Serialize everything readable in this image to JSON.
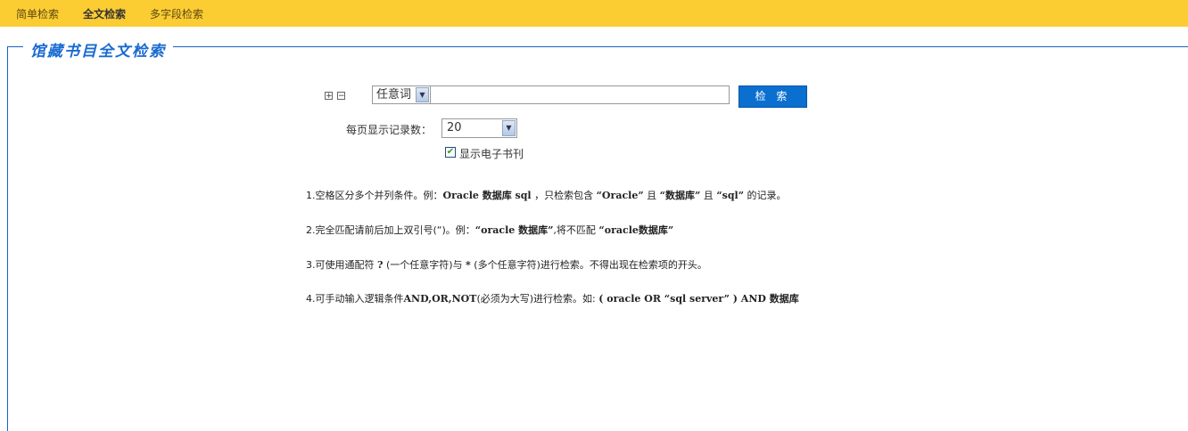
{
  "nav": [
    {
      "label": "简单检索",
      "active": false
    },
    {
      "label": "全文检索",
      "active": true
    },
    {
      "label": "多字段检索",
      "active": false
    }
  ],
  "section_title": "馆藏书目全文检索",
  "search": {
    "field_value": "任意词",
    "query_value": "",
    "button_label": "检 索"
  },
  "per_page": {
    "label": "每页显示记录数：",
    "value": "20"
  },
  "show_ejournal": {
    "label": "显示电子书刊",
    "checked": true
  },
  "tips": [
    [
      {
        "t": "1.空格区分多个并列条件。例："
      },
      {
        "t": "Oracle 数据库 sql",
        "b": 1
      },
      {
        "t": " ，只检索包含 "
      },
      {
        "t": "“Oracle”",
        "b": 1
      },
      {
        "t": " 且 "
      },
      {
        "t": "“数据库”",
        "b": 1
      },
      {
        "t": " 且 "
      },
      {
        "t": "“sql”",
        "b": 1
      },
      {
        "t": " 的记录。"
      }
    ],
    [
      {
        "t": "2.完全匹配请前后加上双引号(“)。例："
      },
      {
        "t": "“oracle 数据库”",
        "b": 1
      },
      {
        "t": ",将不匹配 "
      },
      {
        "t": "“oracle数据库”",
        "b": 1
      }
    ],
    [
      {
        "t": "3.可使用通配符 "
      },
      {
        "t": "?",
        "b": 1
      },
      {
        "t": " (一个任意字符)与 "
      },
      {
        "t": "*",
        "b": 1
      },
      {
        "t": " (多个任意字符)进行检索。不得出现在检索项的开头。"
      }
    ],
    [
      {
        "t": "4.可手动输入逻辑条件"
      },
      {
        "t": "AND,OR,NOT",
        "b": 1
      },
      {
        "t": "(必须为大写)进行检索。如: "
      },
      {
        "t": "( oracle OR “sql server” ) AND 数据库",
        "b": 1
      }
    ]
  ]
}
